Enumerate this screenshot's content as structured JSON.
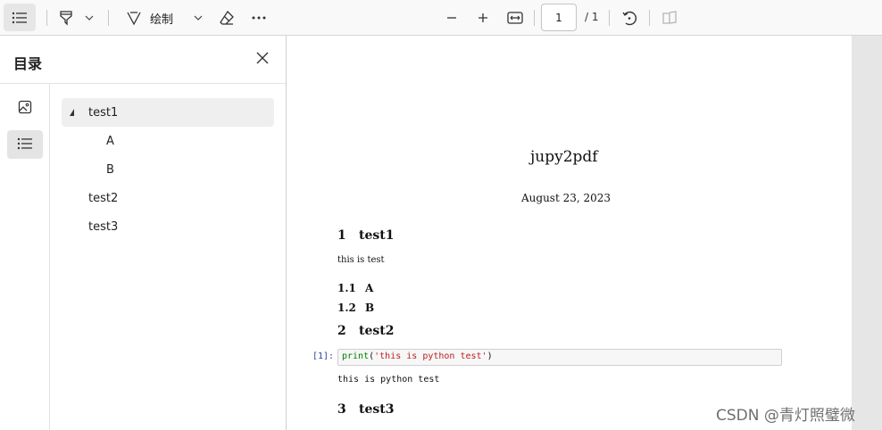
{
  "toolbar": {
    "draw_label": "绘制",
    "page_number": "1",
    "page_total": "/ 1"
  },
  "toc_panel": {
    "title": "目录",
    "items": [
      {
        "label": "test1",
        "expanded": true,
        "selected": true
      },
      {
        "label": "A"
      },
      {
        "label": "B"
      },
      {
        "label": "test2"
      },
      {
        "label": "test3"
      }
    ]
  },
  "document": {
    "title": "jupy2pdf",
    "date": "August 23, 2023",
    "sections": [
      {
        "num": "1",
        "title": "test1",
        "body": "this is test"
      },
      {
        "num": "1.1",
        "title": "A"
      },
      {
        "num": "1.2",
        "title": "B"
      },
      {
        "num": "2",
        "title": "test2"
      },
      {
        "num": "3",
        "title": "test3"
      }
    ],
    "code_cell": {
      "prompt": "[1]:",
      "fn": "print",
      "open": "(",
      "string": "'this is python test'",
      "close": ")",
      "output": "this is python test"
    }
  },
  "watermark": "CSDN @青灯照璧微"
}
